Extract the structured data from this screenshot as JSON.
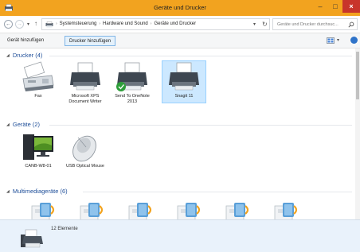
{
  "window": {
    "title": "Geräte und Drucker",
    "minimize_glyph": "–",
    "maximize_glyph": "□",
    "close_glyph": "×"
  },
  "nav": {
    "back_glyph": "←",
    "forward_glyph": "→",
    "dropdown_glyph": "▾",
    "up_glyph": "↑",
    "breadcrumbs": [
      "Systemsteuerung",
      "Hardware und Sound",
      "Geräte und Drucker"
    ],
    "separator": "›",
    "path_dropdown_glyph": "▾",
    "refresh_glyph": "↻",
    "search_placeholder": "Geräte und Drucker durchsuc..."
  },
  "commands": {
    "add_device": "Gerät hinzufügen",
    "add_printer": "Drucker hinzufügen",
    "view_dropdown_glyph": "▾"
  },
  "groups": {
    "printers": {
      "header": "Drucker (4)",
      "items": [
        {
          "label": "Fax",
          "icon": "fax-icon"
        },
        {
          "label": "Microsoft XPS Document Writer",
          "icon": "printer-icon"
        },
        {
          "label": "Send To OneNote 2013",
          "icon": "printer-default-icon"
        },
        {
          "label": "Snagit 11",
          "icon": "printer-icon",
          "selected": true
        }
      ]
    },
    "devices": {
      "header": "Geräte (2)",
      "items": [
        {
          "label": "CANB-W8-01",
          "icon": "computer-icon"
        },
        {
          "label": "USB Optical Mouse",
          "icon": "mouse-icon"
        }
      ]
    },
    "multimedia": {
      "header": "Multimediageräte (6)",
      "item_count": 6,
      "icon": "media-device-icon"
    }
  },
  "details": {
    "count": "12 Elemente",
    "icon": "devices-printers-icon"
  },
  "colors": {
    "titlebar": "#f2a31f",
    "close": "#c8352b",
    "group_header": "#1e4e99",
    "selection": "#cce8ff",
    "details_bg": "#e9f2fb"
  }
}
